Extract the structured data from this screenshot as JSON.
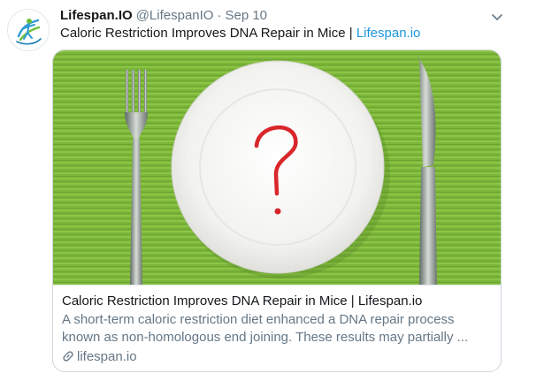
{
  "tweet": {
    "display_name": "Lifespan.IO",
    "handle": "@LifespanIO",
    "separator": "·",
    "date": "Sep 10",
    "text": "Caloric Restriction Improves DNA Repair in Mice | ",
    "link_text": "Lifespan.io"
  },
  "card": {
    "title": "Caloric Restriction Improves DNA Repair in Mice | Lifespan.io",
    "description_line1": "A short-term caloric restriction diet enhanced a DNA repair process",
    "description_line2": "known as non-homologous end joining. These results may partially ...",
    "domain": "lifespan.io"
  },
  "colors": {
    "link": "#1b95e0",
    "secondary_text": "#657786",
    "tablecloth": "#7bb63a",
    "plate": "#f7f7f5",
    "question_mark": "#d8262a"
  },
  "icons": {
    "more": "chevron-down-icon",
    "link": "link-icon",
    "avatar": "lifespan-logo"
  }
}
